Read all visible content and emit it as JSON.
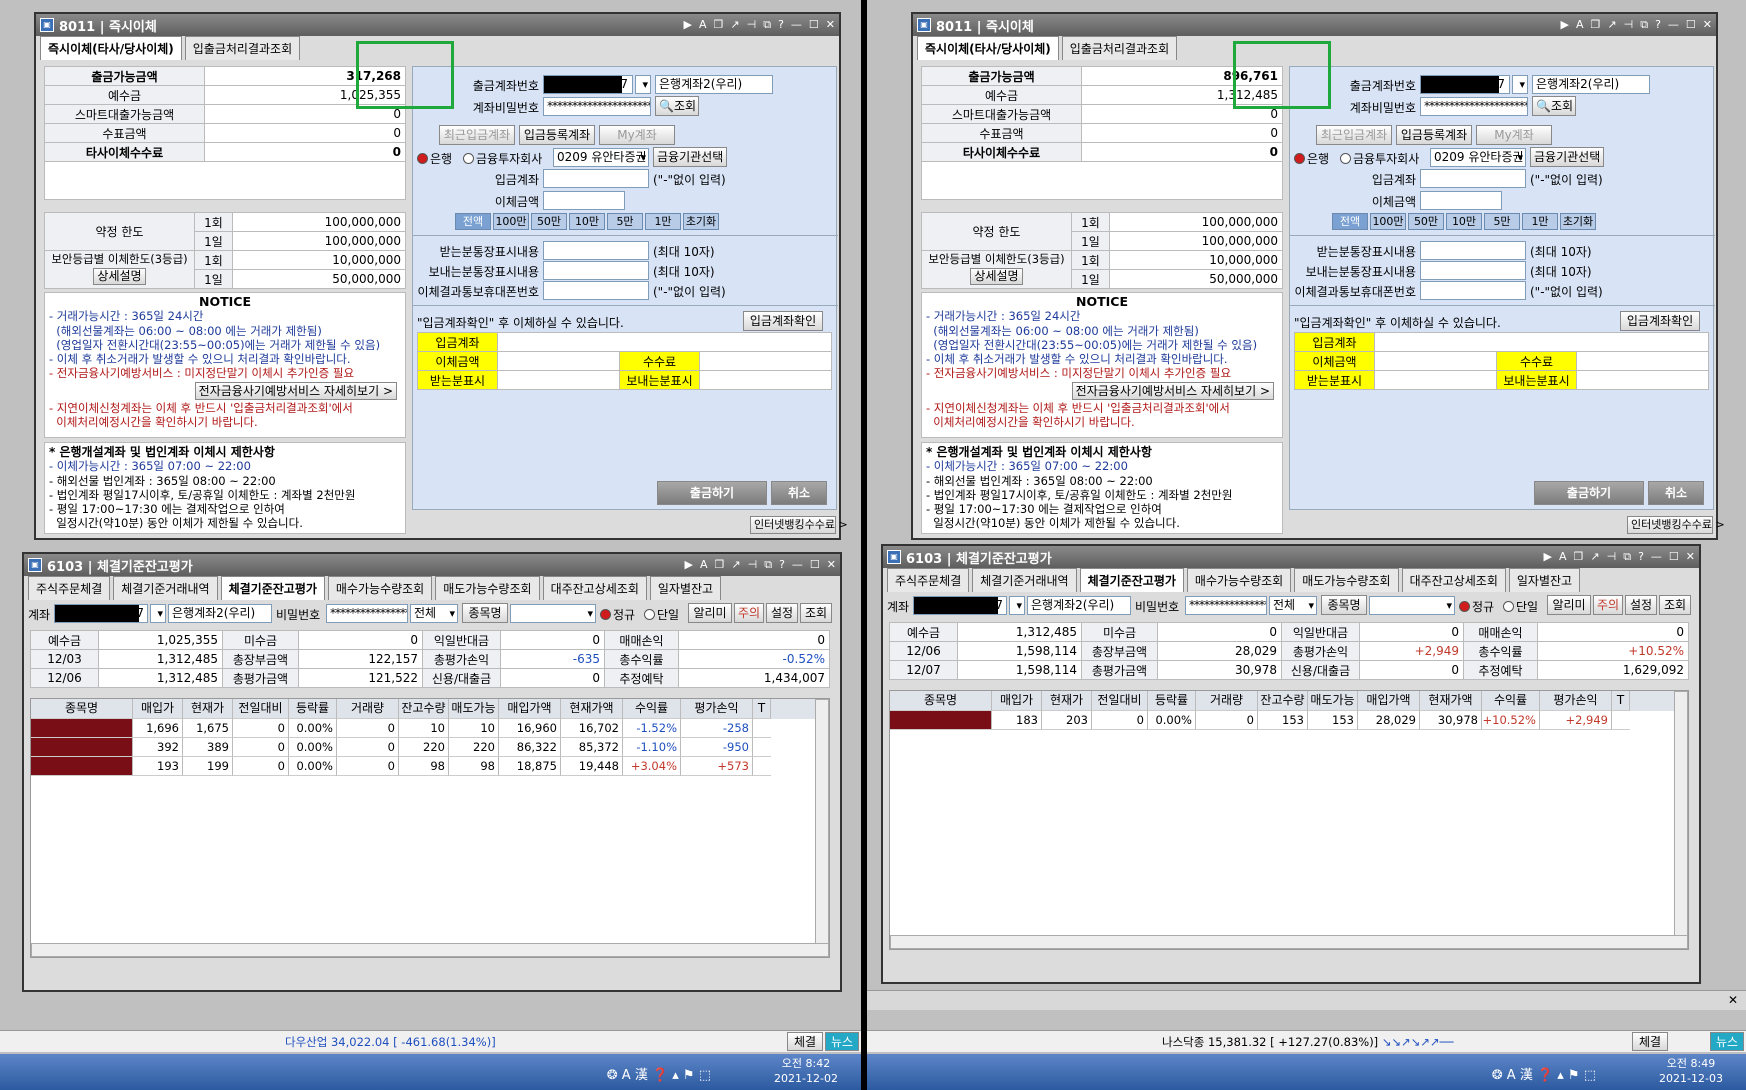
{
  "common": {
    "transfer_window": {
      "code": "8011",
      "title": "즉시이체",
      "tabs": [
        "즉시이체(타사/당사이체)",
        "입출금처리결과조회"
      ],
      "labels": {
        "available": "출금가능금액",
        "deposit": "예수금",
        "smart_loan": "스마트대출가능금액",
        "check": "수표금액",
        "fee": "타사이체수수료",
        "contract_limit": "약정 한도",
        "once": "1회",
        "daily": "1일",
        "security_limit": "보안등급별 이체한도(3등급)",
        "detail_btn": "상세설명",
        "out_account": "출금계좌번호",
        "password": "계좌비밀번호",
        "recent_btn": "최근입금계좌",
        "register_btn": "입금등록계좌",
        "my_btn": "My계좌",
        "bank_radio": "은행",
        "fin_radio": "금융투자회사",
        "fin_org_btn": "금융기관선택",
        "in_account": "입금계좌",
        "amount": "이체금액",
        "recv_memo": "받는분통장표시내용",
        "send_memo": "보내는분통장표시내용",
        "result_phone": "이체결과통보휴대폰번호",
        "max10": "(최대 10자)",
        "nodash": "(\"-\"없이 입력)",
        "confirm_msg": "\"입금계좌확인\" 후 이체하실 수 있습니다.",
        "confirm_btn": "입금계좌확인",
        "box_in": "입금계좌",
        "box_amount": "이체금액",
        "box_fee": "수수료",
        "box_recv": "받는분표시",
        "box_send": "보내는분표시",
        "withdraw_btn": "출금하기",
        "cancel_btn": "취소",
        "netbank_btn": "인터넷뱅킹수수료 >"
      },
      "amount_buttons": [
        "전액",
        "100만",
        "50만",
        "10만",
        "5만",
        "1만",
        "초기화"
      ],
      "limits": {
        "contract_once": "100,000,000",
        "contract_daily": "100,000,000",
        "security_once": "10,000,000",
        "security_daily": "50,000,000"
      },
      "account_name": "은행계좌2(우리)",
      "account_suffix": "7",
      "password_mask": "*********************",
      "lookup_btn": "조회",
      "bank_code": "0209 유안타증권",
      "notice": {
        "title": "NOTICE",
        "lines": [
          "- 거래가능시간 : 365일 24시간",
          "  (해외선물계좌는 06:00 ~ 08:00 에는 거래가 제한됨)",
          "  (영업일자 전환시간대(23:55~00:05)에는 거래가 제한될 수 있음)",
          "- 이체 후 취소거래가 발생할 수 있으니 처리결과 확인바랍니다.",
          "- 전자금융사기예방서비스 : 미지정단말기 이체시 추가인증 필요",
          "- 지연이체신청계좌는 이체 후 반드시 '입출금처리결과조회'에서",
          "  이체처리예정시간을 확인하시기 바랍니다."
        ],
        "service_btn": "전자금융사기예방서비스 자세히보기 >"
      },
      "restrict": {
        "title": "* 은행개설계좌 및 법인계좌 이체시 제한사항",
        "lines": [
          "- 이체가능시간 : 365일 07:00 ~ 22:00",
          "- 해외선물 법인계좌 : 365일 08:00 ~ 22:00",
          "- 법인계좌 평일17시이후, 토/공휴일 이체한도 : 계좌별 2천만원",
          "- 평일 17:00~17:30 에는 결제작업으로 인하여",
          "  일정시간(약10분) 동안 이체가 제한될 수 있습니다."
        ]
      }
    },
    "balance_window": {
      "code": "6103",
      "title": "체결기준잔고평가",
      "tabs": [
        "주식주문체결",
        "체결기준거래내역",
        "체결기준잔고평가",
        "매수가능수량조회",
        "매도가능수량조회",
        "대주잔고상세조회",
        "일자별잔고"
      ],
      "labels": {
        "account": "계좌",
        "password": "비밀번호",
        "all": "전체",
        "stock_name": "종목명",
        "regular": "정규",
        "single": "단일",
        "alert": "알리미",
        "caution": "주의",
        "settings": "설정",
        "lookup": "조회",
        "deposit": "예수금",
        "unpaid": "미수금",
        "next_day": "익일반대금",
        "trade_pl": "매매손익",
        "total_cost": "총장부금액",
        "total_eval_pl": "총평가손익",
        "total_rate": "총수익률",
        "total_eval": "총평가금액",
        "credit_loan": "신용/대출금",
        "est_deposit": "추정예탁"
      },
      "columns": [
        "종목명",
        "매입가",
        "현재가",
        "전일대비",
        "등락률",
        "거래량",
        "잔고수량",
        "매도가능",
        "매입가액",
        "현재가액",
        "수익률",
        "평가손익",
        "T"
      ]
    },
    "taskbar": {
      "news": "뉴스",
      "fill": "체결"
    }
  },
  "left": {
    "transfer": {
      "available": "317,268",
      "deposit": "1,025,355",
      "smart_loan": "0",
      "check": "0",
      "fee": "0"
    },
    "balance": {
      "summary": {
        "deposit": "1,025,355",
        "unpaid": "0",
        "next_day": "0",
        "trade_pl": "0",
        "d1_label": "12/03",
        "d1_value": "1,312,485",
        "total_cost": "122,157",
        "total_eval_pl": "-635",
        "total_rate": "-0.52%",
        "d2_label": "12/06",
        "d2_value": "1,312,485",
        "total_eval": "121,522",
        "credit_loan": "0",
        "est_deposit": "1,434,007"
      },
      "rows": [
        [
          "1,696",
          "1,675",
          "0",
          "0.00%",
          "0",
          "10",
          "10",
          "16,960",
          "16,702",
          "-1.52%",
          "-258"
        ],
        [
          "392",
          "389",
          "0",
          "0.00%",
          "0",
          "220",
          "220",
          "86,322",
          "85,372",
          "-1.10%",
          "-950"
        ],
        [
          "193",
          "199",
          "0",
          "0.00%",
          "0",
          "98",
          "98",
          "18,875",
          "19,448",
          "+3.04%",
          "+573"
        ]
      ]
    },
    "ticker": "다우산업 34,022.04 [ -461.68(1.34%)]",
    "clock": {
      "time": "오전 8:42",
      "date": "2021-12-02"
    }
  },
  "right": {
    "transfer": {
      "available": "896,761",
      "deposit": "1,312,485",
      "smart_loan": "0",
      "check": "0",
      "fee": "0"
    },
    "balance": {
      "summary": {
        "deposit": "1,312,485",
        "unpaid": "0",
        "next_day": "0",
        "trade_pl": "0",
        "d1_label": "12/06",
        "d1_value": "1,598,114",
        "total_cost": "28,029",
        "total_eval_pl": "+2,949",
        "total_rate": "+10.52%",
        "d2_label": "12/07",
        "d2_value": "1,598,114",
        "total_eval": "30,978",
        "credit_loan": "0",
        "est_deposit": "1,629,092"
      },
      "rows": [
        [
          "183",
          "203",
          "0",
          "0.00%",
          "0",
          "153",
          "153",
          "28,029",
          "30,978",
          "+10.52%",
          "+2,949"
        ]
      ]
    },
    "ticker": "나스닥종 15,381.32 [ +127.27(0.83%)]",
    "ticker_arrows": "↘↘↗↘↗↗──",
    "clock": {
      "time": "오전 8:49",
      "date": "2021-12-03"
    }
  }
}
